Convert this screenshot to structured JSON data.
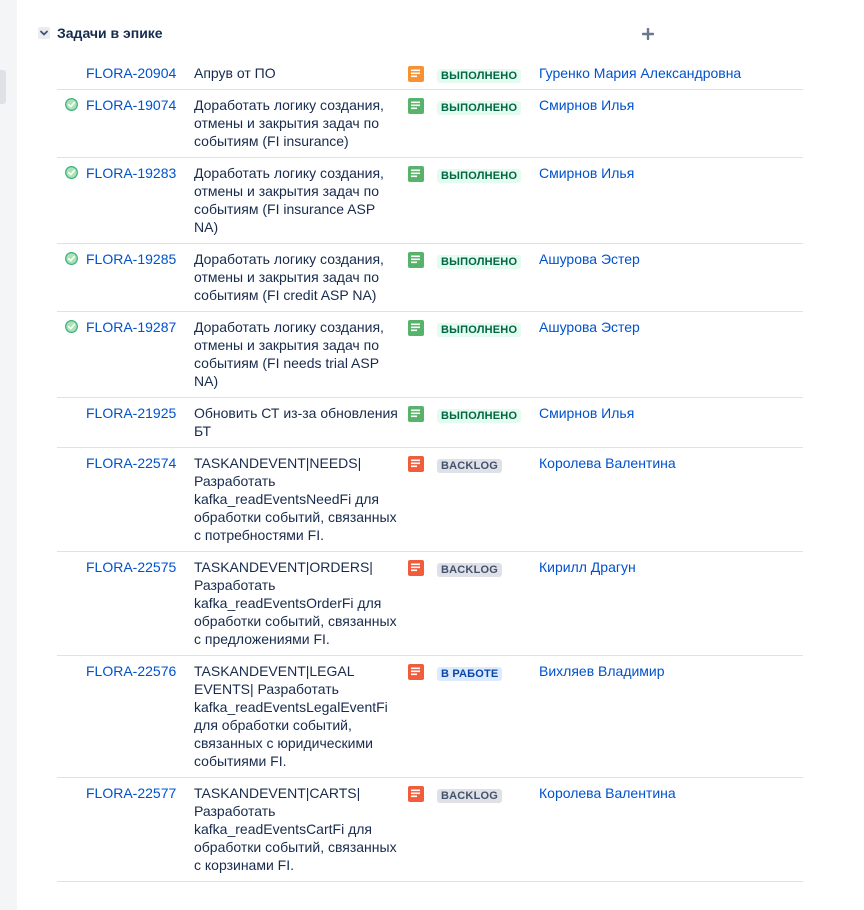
{
  "section": {
    "title": "Задачи в эпике"
  },
  "colors": {
    "link": "#0052cc",
    "done_bg": "#e3fcef",
    "done_fg": "#006644",
    "backlog_bg": "#dfe1e6",
    "backlog_fg": "#42526e",
    "progress_bg": "#deebff",
    "progress_fg": "#0747a6",
    "type_green": "#57b369",
    "type_orange": "#f79232",
    "type_red": "#f15c3c"
  },
  "rows": [
    {
      "key": "FLORA-20904",
      "summary": "Апрув от ПО",
      "type_icon": "orange",
      "status": "ВЫПОЛНЕНО",
      "status_kind": "done",
      "assignee": "Гуренко Мария Александровна",
      "resolved": false
    },
    {
      "key": "FLORA-19074",
      "summary": "Доработать логику создания, отмены и закрытия задач по событиям (FI insurance)",
      "type_icon": "green",
      "status": "ВЫПОЛНЕНО",
      "status_kind": "done",
      "assignee": "Смирнов Илья",
      "resolved": true
    },
    {
      "key": "FLORA-19283",
      "summary": "Доработать логику создания, отмены и закрытия задач по событиям (FI insurance ASP NA)",
      "type_icon": "green",
      "status": "ВЫПОЛНЕНО",
      "status_kind": "done",
      "assignee": "Смирнов Илья",
      "resolved": true
    },
    {
      "key": "FLORA-19285",
      "summary": "Доработать логику создания, отмены и закрытия задач по событиям (FI credit ASP NA)",
      "type_icon": "green",
      "status": "ВЫПОЛНЕНО",
      "status_kind": "done",
      "assignee": "Ашурова Эстер",
      "resolved": true
    },
    {
      "key": "FLORA-19287",
      "summary": "Доработать логику создания, отмены и закрытия задач по событиям (FI needs trial ASP NA)",
      "type_icon": "green",
      "status": "ВЫПОЛНЕНО",
      "status_kind": "done",
      "assignee": "Ашурова Эстер",
      "resolved": true
    },
    {
      "key": "FLORA-21925",
      "summary": "Обновить СТ из-за обновления БТ",
      "type_icon": "green",
      "status": "ВЫПОЛНЕНО",
      "status_kind": "done",
      "assignee": "Смирнов Илья",
      "resolved": false
    },
    {
      "key": "FLORA-22574",
      "summary": "TASKANDEVENT|NEEDS| Разработать kafka_readEventsNeedFi для обработки событий, связанных с потребностями FI.",
      "type_icon": "red",
      "status": "BACKLOG",
      "status_kind": "backlog",
      "assignee": "Королева Валентина",
      "resolved": false
    },
    {
      "key": "FLORA-22575",
      "summary": "TASKANDEVENT|ORDERS| Разработать kafka_readEventsOrderFi для обработки событий, связанных с предложениями FI.",
      "type_icon": "red",
      "status": "BACKLOG",
      "status_kind": "backlog",
      "assignee": "Кирилл Драгун",
      "resolved": false
    },
    {
      "key": "FLORA-22576",
      "summary": "TASKANDEVENT|LEGAL EVENTS| Разработать kafka_readEventsLegalEventFi для обработки событий, связанных с юридическими событиями FI.",
      "type_icon": "red",
      "status": "В РАБОТЕ",
      "status_kind": "progress",
      "assignee": "Вихляев Владимир",
      "resolved": false
    },
    {
      "key": "FLORA-22577",
      "summary": "TASKANDEVENT|CARTS| Разработать kafka_readEventsCartFi для обработки событий, связанных с корзинами FI.",
      "type_icon": "red",
      "status": "BACKLOG",
      "status_kind": "backlog",
      "assignee": "Королева Валентина",
      "resolved": false
    }
  ]
}
